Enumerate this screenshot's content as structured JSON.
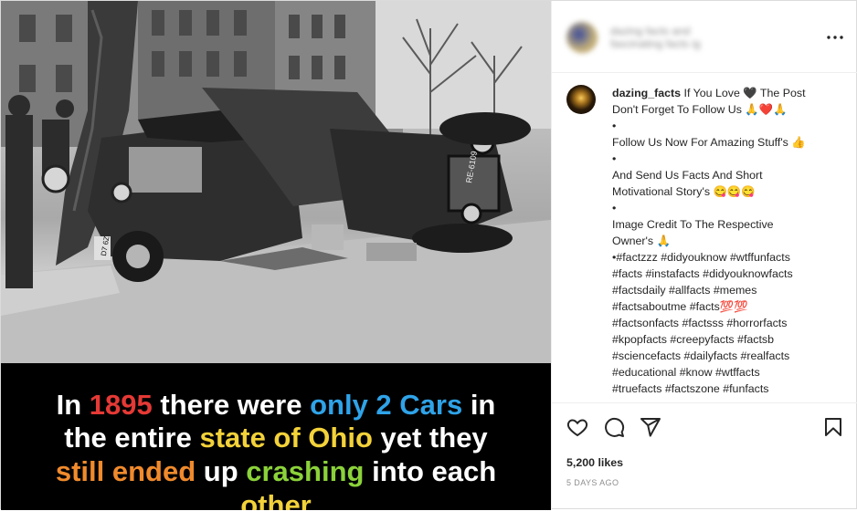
{
  "header": {
    "blurred_name": "dazing facts and fascinating facts ig",
    "more_icon": "more-options-icon"
  },
  "caption": {
    "username": "dazing_facts",
    "lines": [
      "If You Love 🖤 The Post",
      "Don't Forget To Follow Us 🙏❤️🙏",
      "•",
      "Follow Us Now For Amazing Stuff's 👍",
      "•",
      "And Send Us Facts And Short",
      "Motivational Story's 😋😋😋",
      "•",
      "Image Credit To The Respective",
      "Owner's 🙏",
      "•#factzzz #didyouknow #wtffunfacts",
      "#facts #instafacts #didyouknowfacts",
      "#factsdaily #allfacts #memes",
      "#factsaboutme #facts💯💯",
      "#factsonfacts #factsss #horrorfacts",
      "#kpopfacts #creepyfacts #factsb",
      "#sciencefacts #dailyfacts #realfacts",
      "#educational #know #wtffacts",
      "#truefacts #factszone #funfacts"
    ]
  },
  "banner": {
    "line1": [
      {
        "text": "In ",
        "color": "#ffffff"
      },
      {
        "text": "1895",
        "color": "#e53935"
      },
      {
        "text": " there were ",
        "color": "#ffffff"
      },
      {
        "text": "only 2 Cars",
        "color": "#2fa3e8"
      },
      {
        "text": " in",
        "color": "#ffffff"
      }
    ],
    "line2": [
      {
        "text": "the entire ",
        "color": "#ffffff"
      },
      {
        "text": "state of Ohio",
        "color": "#f3d23a"
      },
      {
        "text": " yet they",
        "color": "#ffffff"
      }
    ],
    "line3": [
      {
        "text": "still ended",
        "color": "#f08a2c"
      },
      {
        "text": " up ",
        "color": "#ffffff"
      },
      {
        "text": "crashing",
        "color": "#8bd23a"
      },
      {
        "text": " into each",
        "color": "#ffffff"
      }
    ],
    "line4": [
      {
        "text": "other",
        "color": "#f3d23a"
      }
    ]
  },
  "actions": {
    "like_icon": "heart-icon",
    "comment_icon": "comment-icon",
    "share_icon": "share-icon",
    "save_icon": "bookmark-icon",
    "likes": "5,200 likes",
    "time_ago": "5 DAYS AGO"
  },
  "photo": {
    "plate_front": "RE-6109",
    "plate_rear": "D7 6Z"
  }
}
